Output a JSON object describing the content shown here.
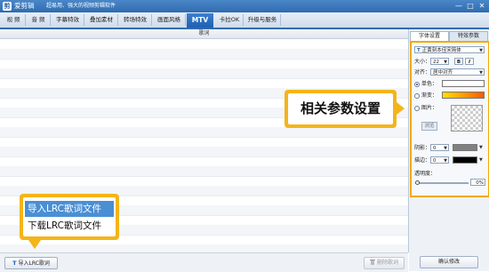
{
  "app": {
    "icon_glyph": "剪",
    "title": "爱剪辑",
    "tagline": "超易用、强大的视频剪辑软件",
    "window_controls": [
      "—",
      "□",
      "✕"
    ]
  },
  "tabs": [
    {
      "label": "视 频",
      "active": false
    },
    {
      "label": "音 频",
      "active": false
    },
    {
      "label": "字幕特效",
      "active": false
    },
    {
      "label": "叠加素材",
      "active": false
    },
    {
      "label": "转场特效",
      "active": false
    },
    {
      "label": "画面风格",
      "active": false
    },
    {
      "label": "MTV",
      "active": true
    },
    {
      "label": "卡拉OK",
      "active": false
    },
    {
      "label": "升级与服务",
      "active": false
    }
  ],
  "lyrics": {
    "column_header": "歌词",
    "row_count": 22
  },
  "bottom_bar": {
    "import_button": "导入LRC歌词",
    "import_icon": "T",
    "delete_button": "删除歌词",
    "delete_icon": "trash-icon",
    "confirm_button": "确认修改"
  },
  "right_panel": {
    "tabs": [
      "字体设置",
      "特效参数"
    ],
    "active_tab": "字体设置",
    "font": {
      "prefix": "T",
      "value": "正黄刻本佳宋简体"
    },
    "size": {
      "label": "大小：",
      "value": "22",
      "bold": "B",
      "italic": "I"
    },
    "align": {
      "label": "对齐：",
      "value": "居中对齐"
    },
    "solid_color": {
      "label": "单色：",
      "checked": true,
      "color": "#ffffff"
    },
    "gradient": {
      "label": "渐变：",
      "checked": false,
      "from": "#ffe000",
      "to": "#ff5a00"
    },
    "texture": {
      "label": "图片：",
      "checked": false,
      "browse_label": "浏览"
    },
    "shadow": {
      "label": "阴影：",
      "value": "0",
      "color": "#808080"
    },
    "stroke": {
      "label": "描边：",
      "value": "0",
      "color": "#000000"
    },
    "opacity": {
      "label": "透明度：",
      "value": "0%",
      "level": 0
    }
  },
  "callouts": {
    "settings": "相关参数设置",
    "lrc_menu": [
      "导入LRC歌词文件",
      "下载LRC歌词文件"
    ],
    "accent": "#f4b41a"
  }
}
